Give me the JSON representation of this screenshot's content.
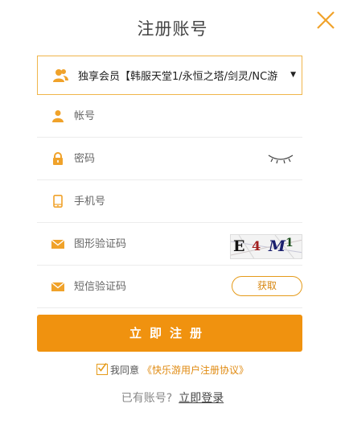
{
  "header": {
    "title": "注册账号"
  },
  "colors": {
    "accent": "#f0920f",
    "border": "#f0b54b",
    "icon": "#f0a22a"
  },
  "form": {
    "server_select": {
      "value": "独享会员【韩服天堂1/永恒之塔/剑灵/NC游",
      "icon": "users-icon"
    },
    "account": {
      "placeholder": "帐号",
      "icon": "user-icon"
    },
    "password": {
      "placeholder": "密码",
      "icon": "lock-icon",
      "toggle_icon": "eye-closed-icon"
    },
    "phone": {
      "placeholder": "手机号",
      "icon": "mobile-icon"
    },
    "image_code": {
      "placeholder": "图形验证码",
      "icon": "mail-icon",
      "captcha_chars": [
        "E",
        "4",
        "M",
        "1"
      ]
    },
    "sms_code": {
      "placeholder": "短信验证码",
      "icon": "mail-icon",
      "get_button": "获取"
    }
  },
  "submit": {
    "label": "立即注册"
  },
  "agreement": {
    "label": "我同意",
    "link": "《快乐游用户注册协议》",
    "checked": true
  },
  "login": {
    "prompt": "已有账号?",
    "link": "立即登录"
  }
}
